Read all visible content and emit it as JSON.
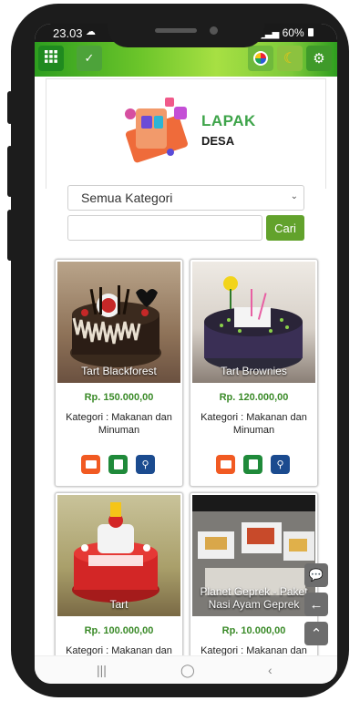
{
  "status": {
    "time": "23.03",
    "signal_icon": "signal-icon",
    "battery": "60%",
    "battery_icon": "battery-icon",
    "upload_icon": "cloud-upload-icon"
  },
  "topbar": {
    "menu_icon": "grid-menu-icon",
    "check_icon": "check-icon",
    "color_icon": "color-wheel-icon",
    "night_icon": "moon-star-icon",
    "settings_icon": "gear-icon"
  },
  "brand": {
    "title": "LAPAK",
    "subtitle": "DESA"
  },
  "filter": {
    "category": "Semua Kategori",
    "search_placeholder": "",
    "search_button": "Cari"
  },
  "products": [
    {
      "name": "Tart Blackforest",
      "price": "Rp. 150.000,00",
      "category": "Kategori : Makanan dan Minuman"
    },
    {
      "name": "Tart Brownies",
      "price": "Rp. 120.000,00",
      "category": "Kategori : Makanan dan Minuman"
    },
    {
      "name": "Tart",
      "price": "Rp. 100.000,00",
      "category": "Kategori : Makanan dan"
    },
    {
      "name": "Planet Geprek - Paket Nasi Ayam Geprek",
      "price": "Rp. 10.000,00",
      "category": "Kategori : Makanan dan"
    }
  ],
  "actions": {
    "folder_icon": "folder-icon",
    "bag_icon": "shopping-bag-icon",
    "location_icon": "location-pin-icon"
  },
  "colors": {
    "green": "#62a22c",
    "price_green": "#3a8a28",
    "orange": "#f15a22",
    "dark_green": "#1f8a3a",
    "blue": "#1b4b8f"
  }
}
